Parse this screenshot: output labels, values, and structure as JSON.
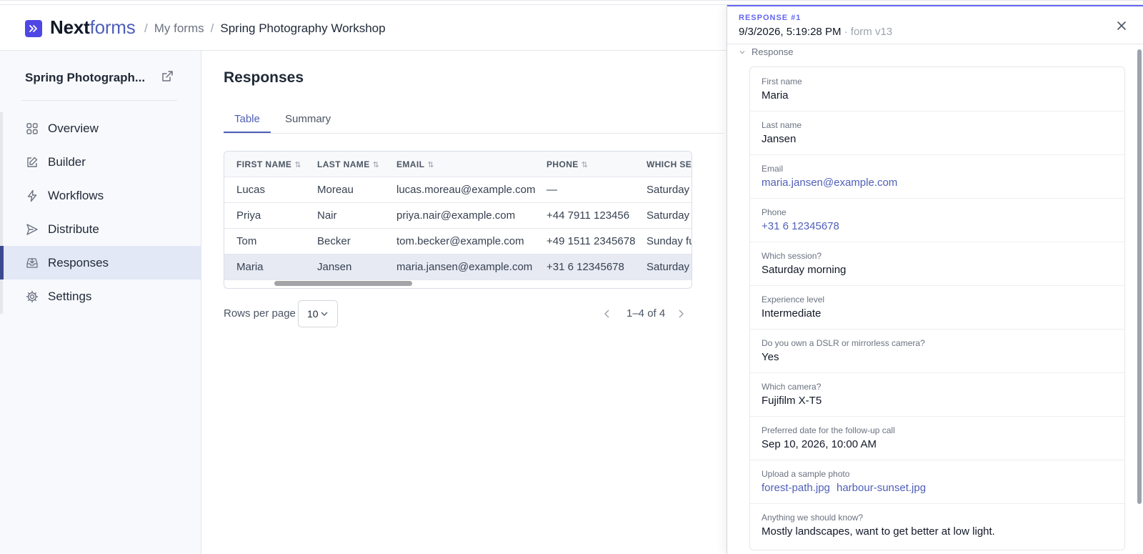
{
  "app": {
    "brand_bold": "Next",
    "brand_light": "forms"
  },
  "breadcrumb": {
    "parent": "My forms",
    "current": "Spring Photography Workshop"
  },
  "sidebar": {
    "form_title": "Spring Photograph...",
    "items": [
      {
        "label": "Overview",
        "icon": "grid-icon"
      },
      {
        "label": "Builder",
        "icon": "edit-icon"
      },
      {
        "label": "Workflows",
        "icon": "bolt-icon"
      },
      {
        "label": "Distribute",
        "icon": "send-icon"
      },
      {
        "label": "Responses",
        "icon": "inbox-icon",
        "active": true
      },
      {
        "label": "Settings",
        "icon": "gear-icon"
      }
    ]
  },
  "main": {
    "title": "Responses",
    "tabs": [
      {
        "label": "Table",
        "active": true
      },
      {
        "label": "Summary"
      }
    ],
    "table": {
      "columns": [
        "FIRST NAME",
        "LAST NAME",
        "EMAIL",
        "PHONE",
        "WHICH SES"
      ],
      "rows": [
        [
          "Lucas",
          "Moreau",
          "lucas.moreau@example.com",
          "—",
          "Saturday m"
        ],
        [
          "Priya",
          "Nair",
          "priya.nair@example.com",
          "+44 7911 123456",
          "Saturday a"
        ],
        [
          "Tom",
          "Becker",
          "tom.becker@example.com",
          "+49 1511 2345678",
          "Sunday fu"
        ],
        [
          "Maria",
          "Jansen",
          "maria.jansen@example.com",
          "+31 6 12345678",
          "Saturday m"
        ]
      ],
      "selected_row": 3
    },
    "pagination": {
      "rows_per_page_label": "Rows per page",
      "rows_per_page": "10",
      "range": "1–4 of 4"
    }
  },
  "panel": {
    "response_number": "RESPONSE #1",
    "datetime": "9/3/2026, 5:19:28 PM",
    "form_version": "· form v13",
    "section_label": "Response",
    "answers": [
      {
        "question": "First name",
        "answer": "Maria"
      },
      {
        "question": "Last name",
        "answer": "Jansen"
      },
      {
        "question": "Email",
        "answer": "maria.jansen@example.com",
        "link": true
      },
      {
        "question": "Phone",
        "answer": "+31 6 12345678",
        "link": true
      },
      {
        "question": "Which session?",
        "answer": "Saturday morning"
      },
      {
        "question": "Experience level",
        "answer": "Intermediate"
      },
      {
        "question": "Do you own a DSLR or mirrorless camera?",
        "answer": "Yes"
      },
      {
        "question": "Which camera?",
        "answer": "Fujifilm X-T5"
      },
      {
        "question": "Preferred date for the follow-up call",
        "answer": "Sep 10, 2026, 10:00 AM"
      },
      {
        "question": "Upload a sample photo",
        "answer": "forest-path.jpg",
        "answer2": "harbour-sunset.jpg",
        "link": true
      },
      {
        "question": "Anything we should know?",
        "answer": "Mostly landscapes, want to get better at low light."
      }
    ]
  },
  "colors": {
    "accent": "#4f5fb8",
    "brand": "#4f46e5",
    "active_bg": "#e3e8f7"
  }
}
